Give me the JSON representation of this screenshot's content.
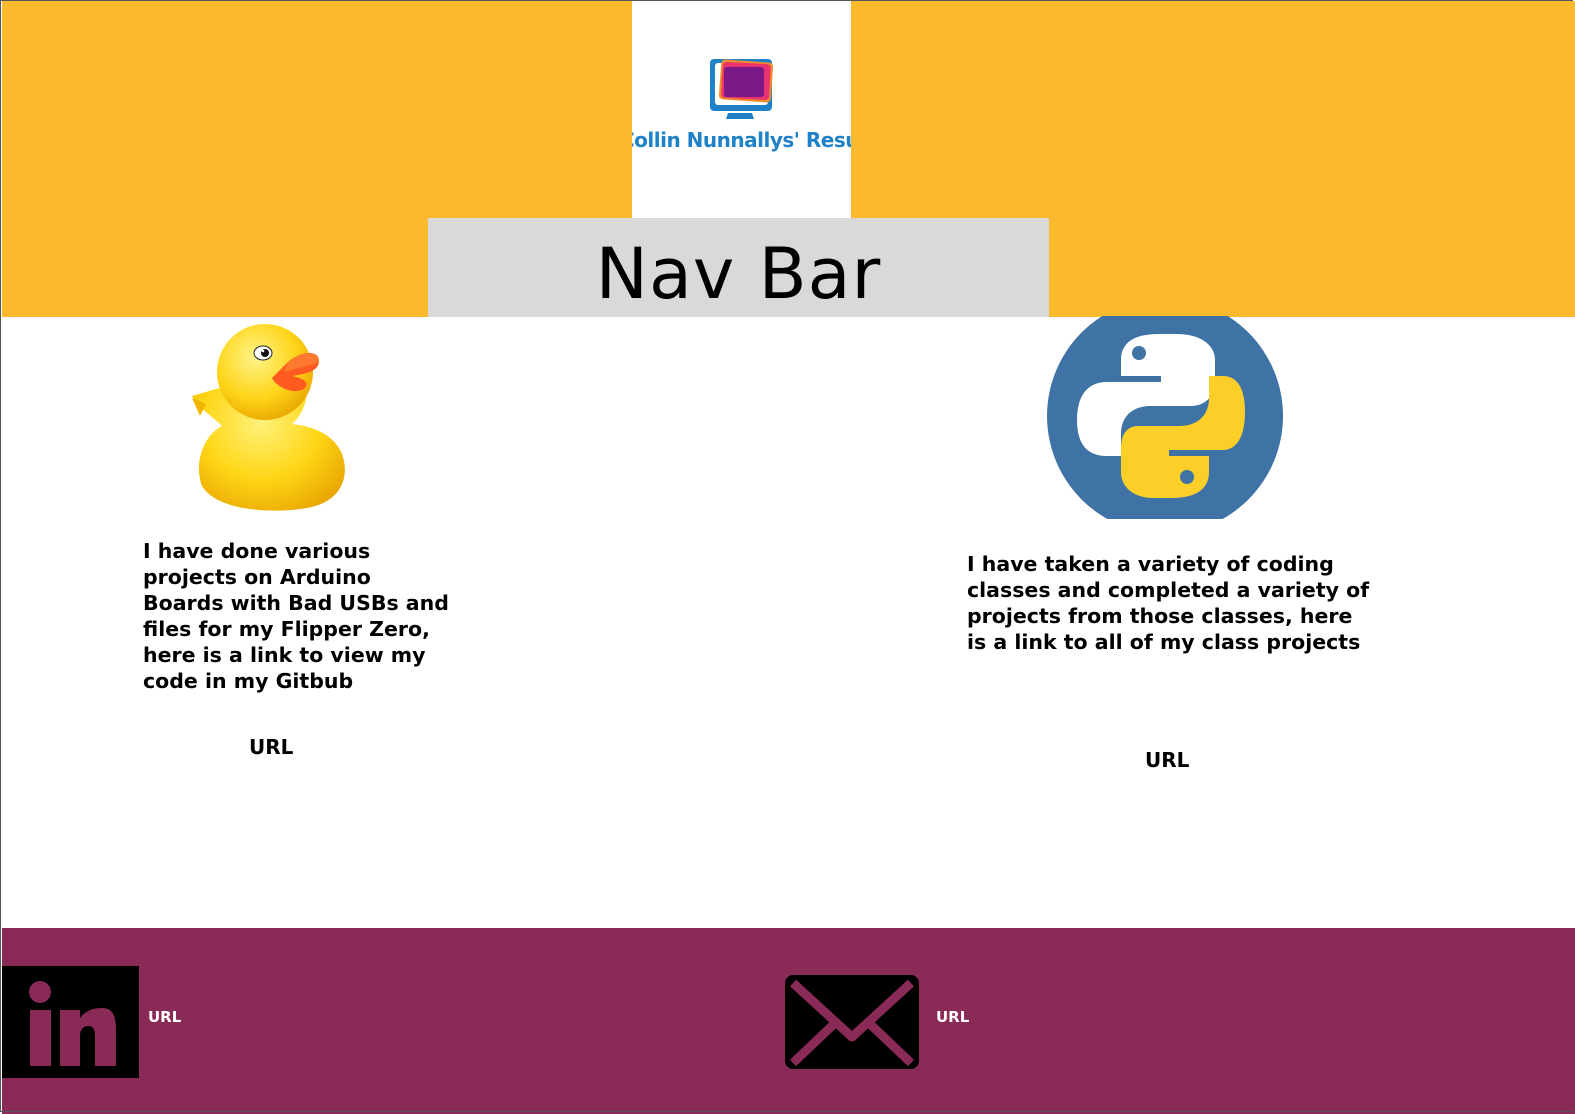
{
  "header": {
    "logo_text": "Collin Nunnallys' Resume",
    "background_color": "#fbba2e",
    "logo_icon": "monitor-icon"
  },
  "nav": {
    "label": "Nav Bar",
    "background_color": "#d9d9d9"
  },
  "sections": {
    "left": {
      "image": "rubber-duck-image",
      "description": "I have done various projects on Arduino Boards with Bad USBs and files for my Flipper Zero, here is a link to view my code in my Gitbub",
      "link_label": "URL"
    },
    "right": {
      "image": "python-logo-image",
      "description": "I have taken a variety of coding classes and completed a variety of projects from those classes, here is a link to all of my class projects",
      "link_label": "URL"
    }
  },
  "footer": {
    "background_color": "#8a2a56",
    "linkedin": {
      "icon": "linkedin-icon",
      "link_label": "URL"
    },
    "email": {
      "icon": "mail-icon",
      "link_label": "URL"
    }
  }
}
